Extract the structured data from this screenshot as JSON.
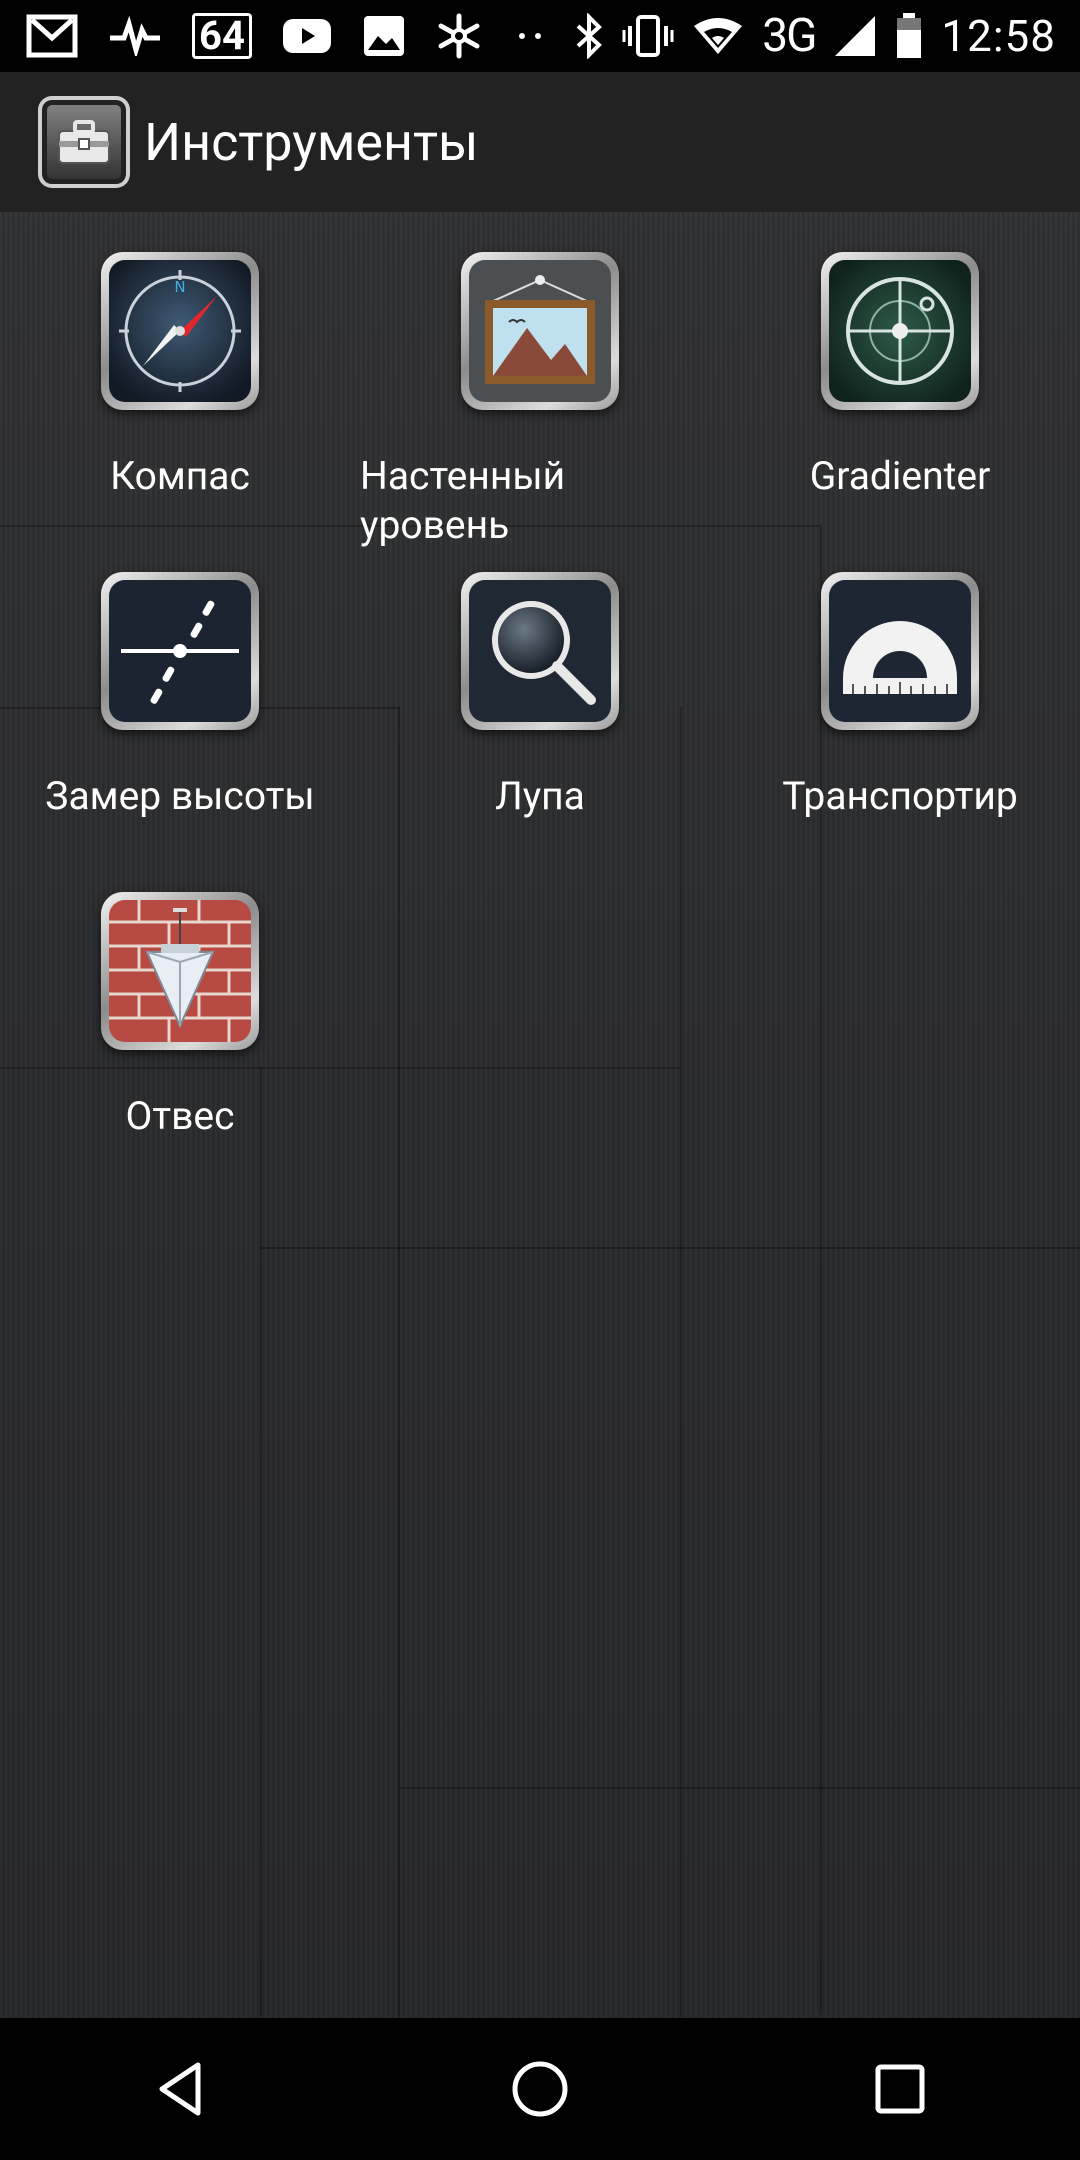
{
  "status_bar": {
    "left_icons": [
      "gmail-icon",
      "pulse-icon",
      "badge-64-icon",
      "youtube-icon",
      "image-icon",
      "snowflake-icon",
      "more-dots-icon"
    ],
    "badge": "64",
    "network": "3G",
    "time": "12:58",
    "right_icons": [
      "bluetooth-icon",
      "vibrate-icon",
      "wifi-icon",
      "signal-icon",
      "battery-icon"
    ]
  },
  "action_bar": {
    "title": "Инструменты",
    "logo_icon": "toolbox-icon"
  },
  "tools": [
    {
      "label": "Компас",
      "icon": "compass-icon"
    },
    {
      "label": "Настенный уровень",
      "icon": "wall-picture-icon"
    },
    {
      "label": "Gradienter",
      "icon": "level-bubble-icon"
    },
    {
      "label": "Замер высоты",
      "icon": "height-measure-icon"
    },
    {
      "label": "Лупа",
      "icon": "magnifier-icon"
    },
    {
      "label": "Транспортир",
      "icon": "protractor-icon"
    },
    {
      "label": "Отвес",
      "icon": "plumb-bob-icon"
    }
  ],
  "nav_bar": {
    "buttons": [
      "back-icon",
      "home-icon",
      "recents-icon"
    ]
  },
  "colors": {
    "background": "#2a2b2d",
    "action_bar": "#222222",
    "bars": "#000000",
    "text": "#ffffff"
  }
}
